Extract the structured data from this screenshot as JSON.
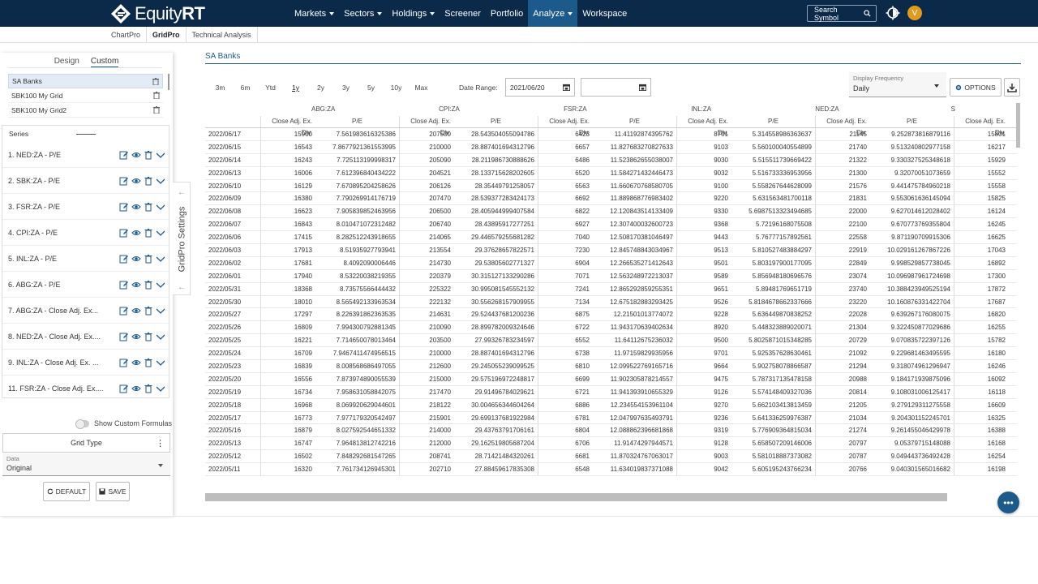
{
  "brand": {
    "name_light": "Equity",
    "name_bold": "RT"
  },
  "nav": {
    "items": [
      {
        "label": "Markets",
        "caret": true,
        "active": false
      },
      {
        "label": "Sectors",
        "caret": true,
        "active": false
      },
      {
        "label": "Holdings",
        "caret": true,
        "active": false
      },
      {
        "label": "Screener",
        "caret": false,
        "active": false
      },
      {
        "label": "Portfolio",
        "caret": false,
        "active": false
      },
      {
        "label": "Analyze",
        "caret": true,
        "active": true
      },
      {
        "label": "Workspace",
        "caret": false,
        "active": false
      }
    ],
    "search_label": "Search Symbol",
    "avatar_initial": "V"
  },
  "subnav": {
    "tabs": [
      "ChartPro",
      "GridPro",
      "Technical Analysis"
    ],
    "active": "GridPro"
  },
  "left": {
    "tab_design": "Design",
    "tab_custom": "Custom",
    "grids": [
      "SA Banks",
      "SBK100 My Grid",
      "SBK100 My Grid2"
    ],
    "series_header": "Series",
    "series": [
      "1. NED:ZA - P/E",
      "2. SBK:ZA - P/E",
      "3. FSR:ZA - P/E",
      "4. CPI:ZA - P/E",
      "5. INL:ZA - P/E",
      "6. ABG:ZA - P/E",
      "7. ABG:ZA - Close Adj. Ex...",
      "8. NED:ZA - Close Adj. Ex....",
      "9. INL:ZA - Close Adj. Ex. ...",
      "11. FSR:ZA - Close Adj. Ex...."
    ],
    "gridpro_settings": "GridPro Settings",
    "show_custom_formulas": "Show Custom Formulas",
    "grid_type": "Grid Type",
    "data_label": "Data",
    "data_value": "Original",
    "default_btn": "DEFAULT",
    "save_btn": "SAVE"
  },
  "main": {
    "title": "SA Banks",
    "periods": [
      "3m",
      "6m",
      "Ytd",
      "1y",
      "2y",
      "3y",
      "5y",
      "10y",
      "Max"
    ],
    "active_period": "1y",
    "date_range_label": "Date Range:",
    "date_from": "2021/06/20",
    "date_to": "",
    "freq_label": "Display Frequency",
    "freq_value": "Daily",
    "options_label": "OPTIONS"
  },
  "table": {
    "groups": [
      "ABG:ZA",
      "CPI:ZA",
      "FSR:ZA",
      "INL:ZA",
      "NED:ZA",
      "S"
    ],
    "col_close": "Close Adj. Ex. Div.",
    "col_pe": "P/E",
    "rows": [
      [
        "2022/06/17",
        "15900",
        "7.561983616325386",
        "207500",
        "28.543504055094786",
        "6423",
        "11.41192874395762",
        "8701",
        "5.314558986363637",
        "21145",
        "9.252873816879116",
        "15801"
      ],
      [
        "2022/06/15",
        "16543",
        "7.8677921361553995",
        "210000",
        "28.887401694312796",
        "6657",
        "11.827683270827633",
        "9103",
        "5.560100040554899",
        "21740",
        "9.513240802977158",
        "16217"
      ],
      [
        "2022/06/14",
        "16243",
        "7.725113199998317",
        "205090",
        "28.211986730888626",
        "6486",
        "11.523862655038007",
        "9030",
        "5.515511739669422",
        "21322",
        "9.330327525348618",
        "15929"
      ],
      [
        "2022/06/13",
        "16006",
        "7.612396840434222",
        "204521",
        "28.133715628202605",
        "6520",
        "11.584271432446473",
        "9032",
        "5.516733336953956",
        "21300",
        "9.32070051073659",
        "15552"
      ],
      [
        "2022/06/10",
        "16129",
        "7.670895204258626",
        "206126",
        "28.35449791258057",
        "6563",
        "11.660670768580705",
        "9100",
        "5.558267644628099",
        "21576",
        "9.441475784960218",
        "15558"
      ],
      [
        "2022/06/09",
        "16380",
        "7.790269914176719",
        "207470",
        "28.539377283424173",
        "6692",
        "11.889868776983402",
        "9220",
        "5.631563481700118",
        "21831",
        "9.553061636145094",
        "15825"
      ],
      [
        "2022/06/08",
        "16623",
        "7.905839852463956",
        "206500",
        "28.405944999407584",
        "6822",
        "12.120843514133409",
        "9330",
        "5.6987513323494685",
        "22000",
        "9.627014612028402",
        "16124"
      ],
      [
        "2022/06/07",
        "16843",
        "8.010471072312482",
        "206740",
        "28.43895917277251",
        "6927",
        "12.307400032600723",
        "9368",
        "5.72196168075508",
        "22100",
        "9.670773769355804",
        "16245"
      ],
      [
        "2022/06/06",
        "17415",
        "8.282512243918655",
        "214065",
        "29.446579255681282",
        "7040",
        "12.508170381046497",
        "9443",
        "5.76777157892561",
        "22558",
        "9.871190709915306",
        "16625"
      ],
      [
        "2022/06/03",
        "17913",
        "8.51935927793941",
        "213554",
        "29.37628657822571",
        "7230",
        "12.845748843034967",
        "9513",
        "5.810527483884297",
        "22919",
        "10.029161267867226",
        "17043"
      ],
      [
        "2022/06/02",
        "17681",
        "8.4092090006446",
        "214730",
        "29.53805602771327",
        "6904",
        "12.266535271412643",
        "9501",
        "5.803197900177095",
        "22849",
        "9.998529857738045",
        "16892"
      ],
      [
        "2022/06/01",
        "17940",
        "8.53220038219355",
        "220379",
        "30.315127133290286",
        "7071",
        "12.563248972213037",
        "9589",
        "5.856948180696576",
        "23074",
        "10.096987961724698",
        "17300"
      ],
      [
        "2022/05/31",
        "18368",
        "8.73575566444432",
        "225322",
        "30.995081545552132",
        "7241",
        "12.865292859255351",
        "9651",
        "5.89481769651719",
        "23740",
        "10.388423949525194",
        "17872"
      ],
      [
        "2022/05/30",
        "18010",
        "8.565492133963534",
        "222132",
        "30.556268157909955",
        "7134",
        "12.675182883293425",
        "9526",
        "5.8184678662337666",
        "23220",
        "10.160876331422704",
        "17687"
      ],
      [
        "2022/05/27",
        "17297",
        "8.226391862363535",
        "214631",
        "29.524437681200236",
        "6875",
        "12.21501013774072",
        "9228",
        "5.636449870838252",
        "22028",
        "9.639267176080075",
        "16820"
      ],
      [
        "2022/05/26",
        "16809",
        "7.994300792881345",
        "210090",
        "28.899782009324646",
        "6722",
        "11.943170639402634",
        "8920",
        "5.448323889020071",
        "21304",
        "9.322450877029686",
        "16255"
      ],
      [
        "2022/05/25",
        "16221",
        "7.714650078013464",
        "203500",
        "27.99326783234597",
        "6552",
        "11.64112675236032",
        "9500",
        "5.8025871015348285",
        "20729",
        "9.070835722397126",
        "15782"
      ],
      [
        "2022/05/24",
        "16709",
        "7.9467411474956515",
        "210000",
        "28.887401694312796",
        "6738",
        "11.97159829935956",
        "9701",
        "5.925357628630461",
        "21092",
        "9.229681463495595",
        "16180"
      ],
      [
        "2022/05/23",
        "16839",
        "8.008568686497055",
        "212600",
        "29.245055239099525",
        "6810",
        "12.099522769165716",
        "9664",
        "5.902758078866587",
        "21294",
        "9.318074961296947",
        "16246"
      ],
      [
        "2022/05/20",
        "16556",
        "7.873974890055539",
        "215000",
        "29.575196972248817",
        "6699",
        "11.902305878214557",
        "9475",
        "5.787317135478158",
        "20988",
        "9.184171939875096",
        "16092"
      ],
      [
        "2022/05/19",
        "16734",
        "7.958631058842075",
        "217470",
        "29.91496784029621",
        "6721",
        "11.941393910655329",
        "9126",
        "5.574148409327036",
        "20814",
        "9.108031006125417",
        "16118"
      ],
      [
        "2022/05/18",
        "16968",
        "8.069920629044601",
        "218122",
        "30.004656344604264",
        "6886",
        "12.234554153961104",
        "9270",
        "5.662103413813459",
        "21205",
        "9.279129311275558",
        "16609"
      ],
      [
        "2022/05/17",
        "16773",
        "7.977179320542497",
        "215901",
        "29.699137681922984",
        "6781",
        "12.047997635493791",
        "9236",
        "5.641336259976387",
        "21034",
        "9.204301152245701",
        "16325"
      ],
      [
        "2022/05/16",
        "16879",
        "8.027592544651332",
        "214000",
        "29.43763791706161",
        "6804",
        "12.088862396681868",
        "9319",
        "5.776909364815034",
        "21274",
        "9.261455046429978",
        "16388"
      ],
      [
        "2022/05/13",
        "16747",
        "7.964813812742216",
        "212000",
        "29.162519805687204",
        "6706",
        "11.91474297944571",
        "9128",
        "5.658507209146006",
        "20797",
        "9.05379715148088",
        "16168"
      ],
      [
        "2022/05/12",
        "16502",
        "7.848292681547265",
        "208741",
        "28.71421484320261",
        "6681",
        "11.870324767063017",
        "9003",
        "5.581018887373082",
        "20787",
        "9.049443736492428",
        "16254"
      ],
      [
        "2022/05/11",
        "16320",
        "7.761734126945301",
        "202710",
        "27.88459617835308",
        "6548",
        "11.634019837371088",
        "9042",
        "5.605195243766234",
        "20766",
        "9.040301565016682",
        "16198"
      ]
    ]
  }
}
